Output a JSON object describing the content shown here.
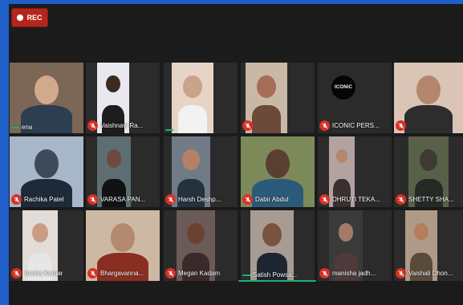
{
  "recording": {
    "label": "REC"
  },
  "rows": [
    [
      {
        "name": "ena",
        "muted": false
      },
      {
        "name": "Vaishnavi Ra...",
        "muted": true
      },
      {
        "name": "",
        "muted": false
      },
      {
        "name": "",
        "muted": true
      },
      {
        "name": "ICONIC PERS...",
        "muted": true,
        "logo": "ICONIC"
      },
      {
        "name": "",
        "muted": true
      }
    ],
    [
      {
        "name": "Rachika Patel",
        "muted": true
      },
      {
        "name": "VARASA PAN...",
        "muted": true
      },
      {
        "name": "Harsh Deshp...",
        "muted": true
      },
      {
        "name": "Dabir Abdul",
        "muted": true
      },
      {
        "name": "DHRUTI TEKA...",
        "muted": true
      },
      {
        "name": "SHETTY SHA...",
        "muted": true
      }
    ],
    [
      {
        "name": "Ansha Kumar",
        "muted": true
      },
      {
        "name": "Bhargavanna...",
        "muted": true
      },
      {
        "name": "Megan Kadam",
        "muted": true
      },
      {
        "name": "Satish Powsa...",
        "muted": false
      },
      {
        "name": "manisha jadh...",
        "muted": true
      },
      {
        "name": "Vaishali Dhon...",
        "muted": true
      }
    ]
  ],
  "colors": {
    "mic_muted": "#d93025",
    "active_speaker": "#19b07a",
    "rec": "#b3261e"
  }
}
